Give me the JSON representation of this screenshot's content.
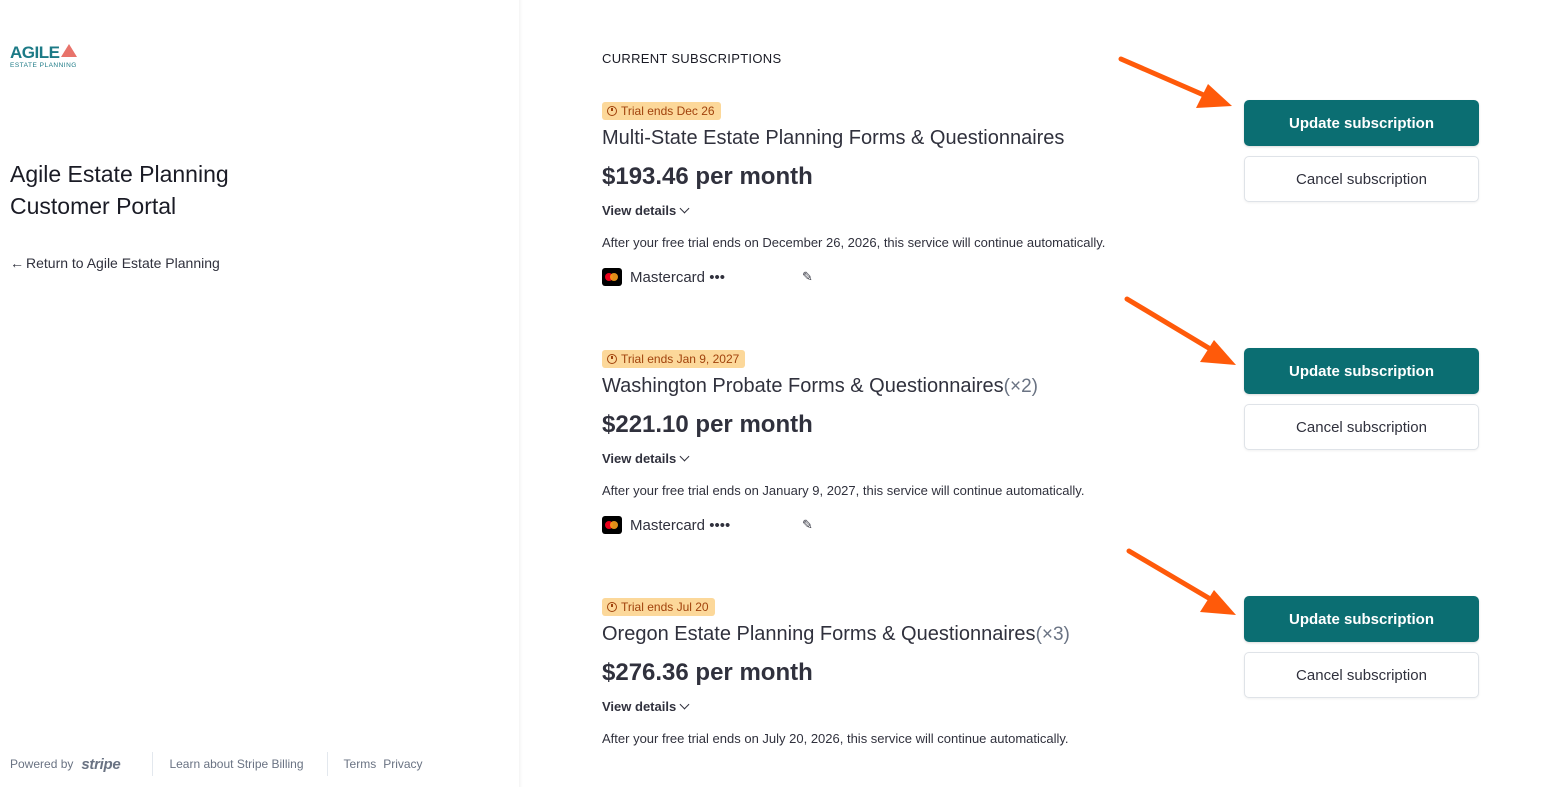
{
  "sidebar": {
    "logo": {
      "word": "AGILE",
      "sub": "ESTATE PLANNING"
    },
    "portal_title": "Agile Estate Planning Customer Portal",
    "return_link": "Return to Agile Estate Planning",
    "footer": {
      "powered_by": "Powered by",
      "brand": "stripe",
      "learn": "Learn about Stripe Billing",
      "terms": "Terms",
      "privacy": "Privacy"
    }
  },
  "main": {
    "section_label": "CURRENT SUBSCRIPTIONS",
    "view_details_label": "View details",
    "update_label": "Update subscription",
    "cancel_label": "Cancel subscription",
    "subscriptions": [
      {
        "badge": "Trial ends Dec 26",
        "name": "Multi-State Estate Planning Forms & Questionnaires",
        "qty": "",
        "price": "$193.46 per month",
        "note": "After your free trial ends on December 26, 2026, this service will continue automatically.",
        "card": "Mastercard •••"
      },
      {
        "badge": "Trial ends Jan 9, 2027",
        "name": "Washington Probate Forms & Questionnaires",
        "qty": "(×2)",
        "price": "$221.10 per month",
        "note": "After your free trial ends on January 9, 2027, this service will continue automatically.",
        "card": "Mastercard ••••"
      },
      {
        "badge": "Trial ends Jul 20",
        "name": "Oregon Estate Planning Forms & Questionnaires",
        "qty": "(×3)",
        "price": "$276.36 per month",
        "note": "After your free trial ends on July 20, 2026, this service will continue automatically."
      }
    ]
  },
  "colors": {
    "primary_button": "#0b6e72",
    "badge_bg": "#fcd89a",
    "badge_text": "#a1420c",
    "annotation_arrow": "#ff5a0a",
    "logo": "#1c7a86"
  }
}
